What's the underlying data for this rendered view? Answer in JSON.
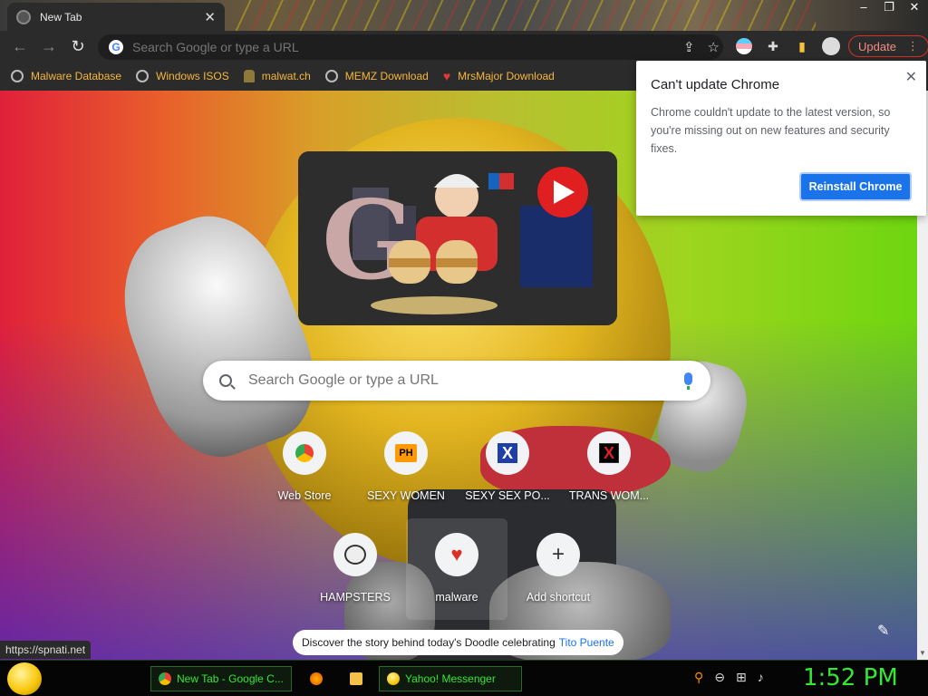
{
  "window": {
    "tab_title": "New Tab",
    "tab_close": "✕",
    "controls": [
      "‒",
      "❐",
      "✕"
    ]
  },
  "toolbar": {
    "back": "←",
    "forward": "→",
    "reload": "↻",
    "omnibox_placeholder": "Search Google or type a URL",
    "share_icon": "⇪",
    "star_icon": "☆",
    "extensions_icon": "✚",
    "sidepanel_icon": "▮",
    "update_label": "Update",
    "menu_icon": "⋮"
  },
  "bookmarks": [
    {
      "label": "Malware Database",
      "icon": "globe-icon"
    },
    {
      "label": "Windows ISOS",
      "icon": "globe-icon"
    },
    {
      "label": "malwat.ch",
      "icon": "figure-icon"
    },
    {
      "label": "MEMZ Download",
      "icon": "globe-icon"
    },
    {
      "label": "MrsMajor Download",
      "icon": "heart-icon"
    }
  ],
  "ntp": {
    "search_placeholder": "Search Google or type a URL",
    "shortcuts": [
      {
        "label": "Web Store",
        "icon": "chrome-web-store-icon"
      },
      {
        "label": "SEXY WOMEN",
        "icon": "ph-icon",
        "glyph": "PH"
      },
      {
        "label": "SEXY SEX PO...",
        "icon": "x-blue-icon",
        "glyph": "X"
      },
      {
        "label": "TRANS WOM...",
        "icon": "x-red-icon",
        "glyph": "X"
      },
      {
        "label": "HAMPSTERS",
        "icon": "hamster-icon"
      },
      {
        "label": "malware",
        "icon": "heart-icon",
        "glyph": "♥"
      },
      {
        "label": "Add shortcut",
        "icon": "plus-icon",
        "glyph": "+"
      }
    ],
    "doodle_text": "Discover the story behind today's Doodle celebrating",
    "doodle_link": "Tito Puente",
    "customize_icon": "✎",
    "status_url": "https://spnati.net"
  },
  "popup": {
    "title": "Can't update Chrome",
    "body": "Chrome couldn't update to the latest version, so you're missing out on new features and security fixes.",
    "button": "Reinstall Chrome",
    "close": "✕"
  },
  "taskbar": {
    "tasks": [
      {
        "label": "New Tab - Google C...",
        "icon": "chrome-icon"
      },
      {
        "label": "Yahoo! Messenger",
        "icon": "yahoo-smiley-icon"
      }
    ],
    "clock": "1:52 PM"
  },
  "colors": {
    "accent": "#1a73e8",
    "bookmark_text": "#f6b73c",
    "taskbar_text": "#35e635",
    "update_border": "#d93025"
  }
}
